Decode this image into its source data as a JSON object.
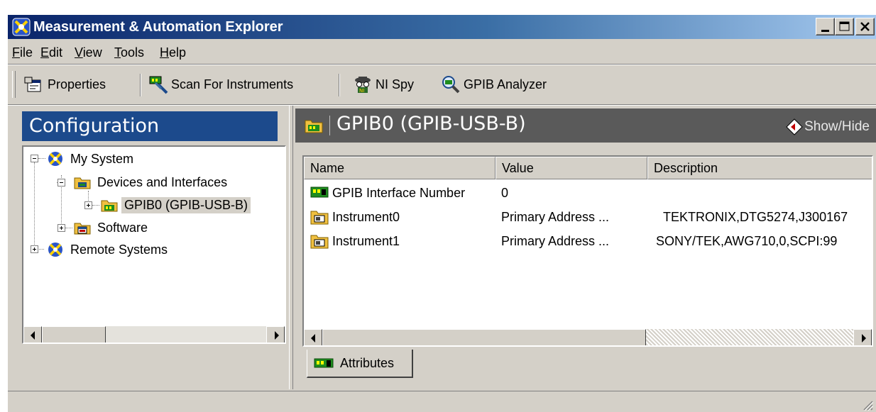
{
  "window": {
    "title": "Measurement & Automation Explorer",
    "title_icon": "max-icon",
    "controls": [
      "minimize",
      "maximize",
      "close"
    ]
  },
  "menu": {
    "items": [
      {
        "label_u": "F",
        "label_rest": "ile"
      },
      {
        "label_u": "E",
        "label_rest": "dit"
      },
      {
        "label_u": "V",
        "label_rest": "iew"
      },
      {
        "label_u": "T",
        "label_rest": "ools"
      },
      {
        "label_u": "H",
        "label_rest": "elp"
      }
    ]
  },
  "toolbar": {
    "properties": "Properties",
    "scan": "Scan For Instruments",
    "ni_spy": "NI Spy",
    "gpib_analyzer": "GPIB Analyzer"
  },
  "config": {
    "header": "Configuration",
    "tree": [
      {
        "label": "My System",
        "icon": "globe-icon",
        "expanded": true
      },
      {
        "label": "Devices and Interfaces",
        "icon": "folder-icon",
        "expanded": true
      },
      {
        "label": "GPIB0 (GPIB-USB-B)",
        "icon": "gpib-card-icon",
        "expanded": false,
        "selected": true
      },
      {
        "label": "Software",
        "icon": "software-icon",
        "expanded": false
      },
      {
        "label": "Remote Systems",
        "icon": "globe-icon",
        "expanded": false
      }
    ]
  },
  "detail": {
    "title": "GPIB0 (GPIB-USB-B)",
    "show_hide": "Show/Hide",
    "columns": [
      "Name",
      "Value",
      "Description"
    ],
    "rows": [
      {
        "name": "GPIB Interface Number",
        "value": "0",
        "description": "",
        "icon": "gpib-card-icon"
      },
      {
        "name": "Instrument0",
        "value": "Primary Address ...",
        "description": "TEKTRONIX,DTG5274,J300167",
        "icon": "instrument-icon"
      },
      {
        "name": "Instrument1",
        "value": "Primary Address ...",
        "description": "SONY/TEK,AWG710,0,SCPI:99",
        "icon": "instrument-icon"
      }
    ],
    "tab": "Attributes"
  },
  "colors": {
    "title_start": "#0a246a",
    "title_end": "#a6caf0",
    "config_header": "#1c4a8c",
    "detail_header": "#5a5a5a",
    "face": "#d4d0c8"
  }
}
